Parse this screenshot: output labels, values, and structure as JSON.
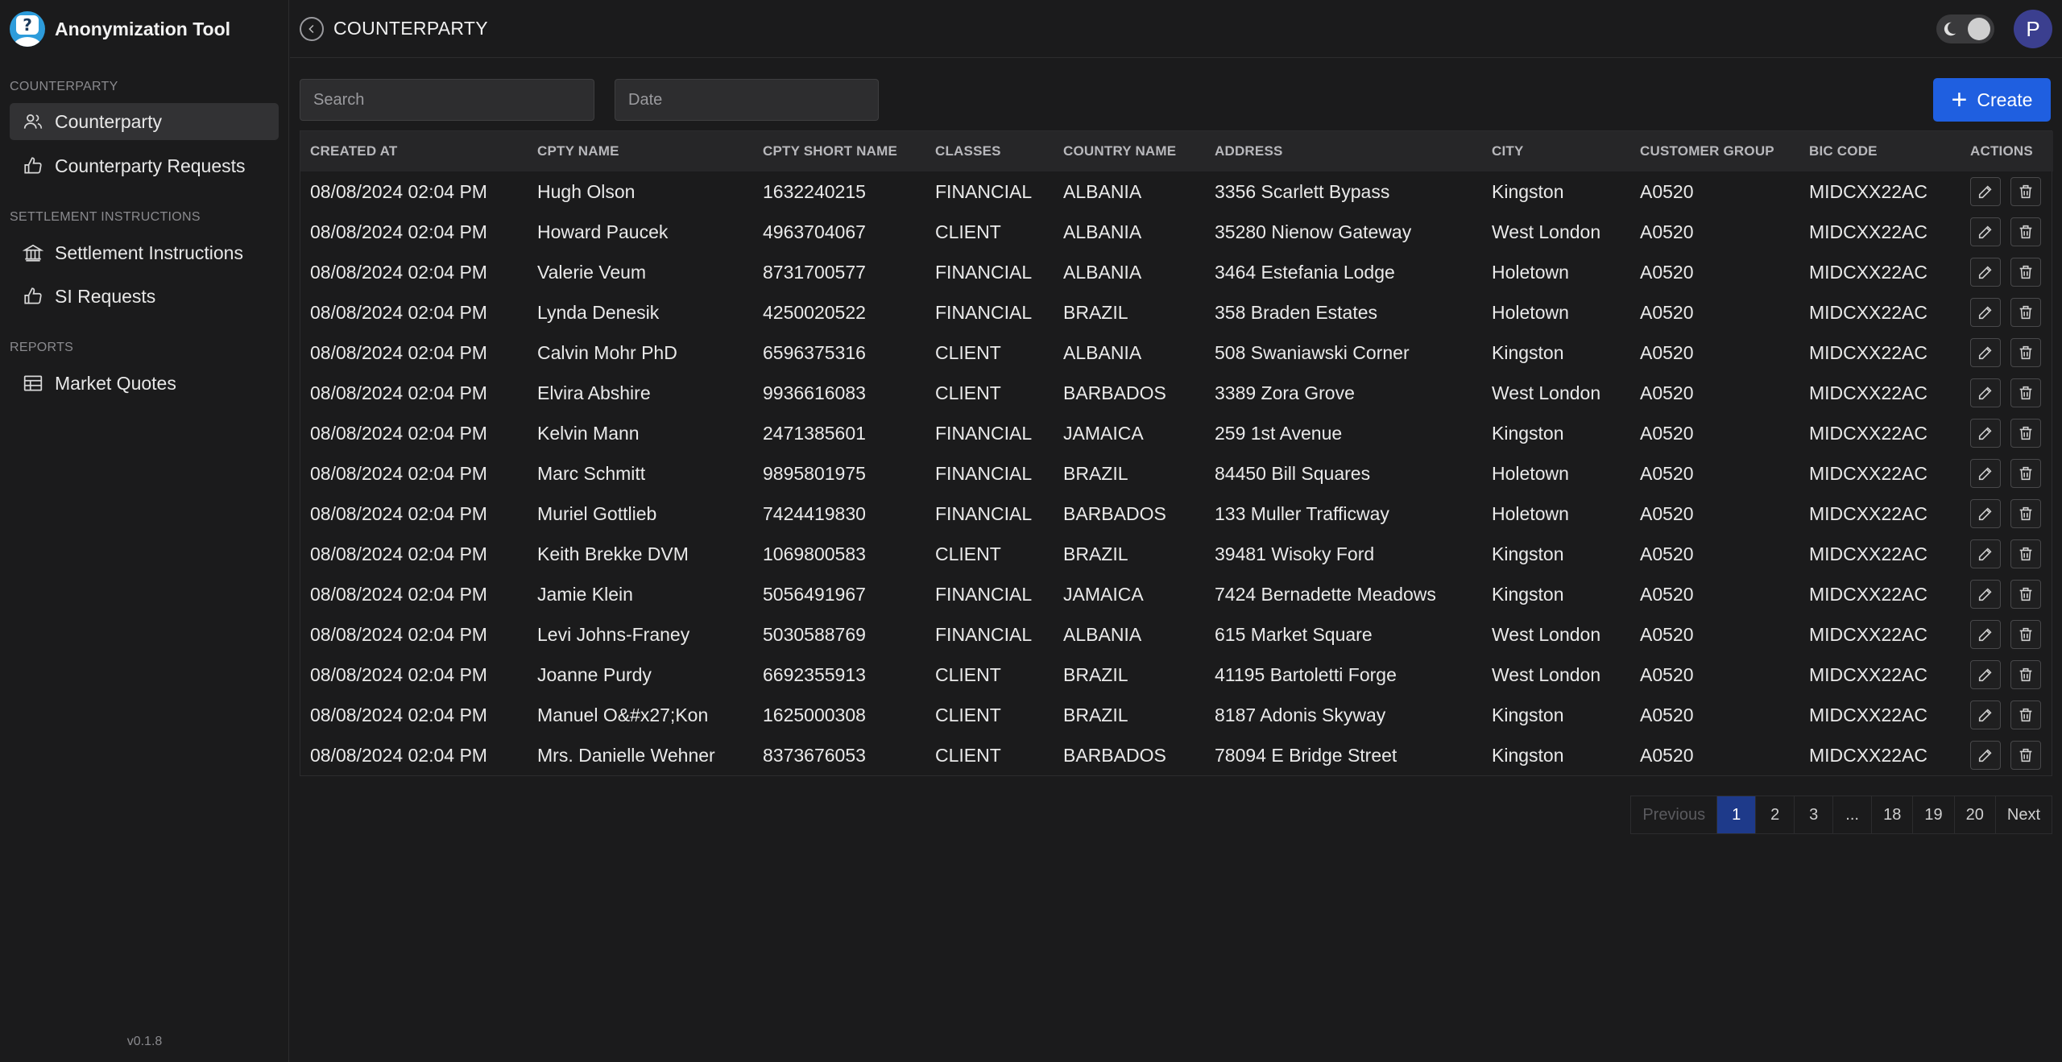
{
  "app": {
    "title": "Anonymization Tool",
    "version": "v0.1.8"
  },
  "sidebar": {
    "sections": [
      {
        "label": "COUNTERPARTY",
        "items": [
          {
            "label": "Counterparty",
            "icon": "users-icon",
            "active": true
          },
          {
            "label": "Counterparty Requests",
            "icon": "thumbs-up-icon",
            "active": false
          }
        ]
      },
      {
        "label": "SETTLEMENT INSTRUCTIONS",
        "items": [
          {
            "label": "Settlement Instructions",
            "icon": "bank-icon",
            "active": false
          },
          {
            "label": "SI Requests",
            "icon": "thumbs-up-icon",
            "active": false
          }
        ]
      },
      {
        "label": "REPORTS",
        "items": [
          {
            "label": "Market Quotes",
            "icon": "table-icon",
            "active": false
          }
        ]
      }
    ]
  },
  "header": {
    "title": "COUNTERPARTY",
    "avatar_initial": "P"
  },
  "filters": {
    "search_placeholder": "Search",
    "date_placeholder": "Date"
  },
  "toolbar": {
    "create_label": "Create"
  },
  "colors": {
    "accent": "#1f5fe0",
    "active_page": "#1e3a8a",
    "background": "#1b1b1c"
  },
  "table": {
    "columns": [
      "CREATED AT",
      "CPTY NAME",
      "CPTY SHORT NAME",
      "CLASSES",
      "COUNTRY NAME",
      "ADDRESS",
      "CITY",
      "CUSTOMER GROUP",
      "BIC CODE",
      "ACTIONS"
    ],
    "rows": [
      [
        "08/08/2024 02:04 PM",
        "Hugh Olson",
        "1632240215",
        "FINANCIAL",
        "ALBANIA",
        "3356 Scarlett Bypass",
        "Kingston",
        "A0520",
        "MIDCXX22AC"
      ],
      [
        "08/08/2024 02:04 PM",
        "Howard Paucek",
        "4963704067",
        "CLIENT",
        "ALBANIA",
        "35280 Nienow Gateway",
        "West London",
        "A0520",
        "MIDCXX22AC"
      ],
      [
        "08/08/2024 02:04 PM",
        "Valerie Veum",
        "8731700577",
        "FINANCIAL",
        "ALBANIA",
        "3464 Estefania Lodge",
        "Holetown",
        "A0520",
        "MIDCXX22AC"
      ],
      [
        "08/08/2024 02:04 PM",
        "Lynda Denesik",
        "4250020522",
        "FINANCIAL",
        "BRAZIL",
        "358 Braden Estates",
        "Holetown",
        "A0520",
        "MIDCXX22AC"
      ],
      [
        "08/08/2024 02:04 PM",
        "Calvin Mohr PhD",
        "6596375316",
        "CLIENT",
        "ALBANIA",
        "508 Swaniawski Corner",
        "Kingston",
        "A0520",
        "MIDCXX22AC"
      ],
      [
        "08/08/2024 02:04 PM",
        "Elvira Abshire",
        "9936616083",
        "CLIENT",
        "BARBADOS",
        "3389 Zora Grove",
        "West London",
        "A0520",
        "MIDCXX22AC"
      ],
      [
        "08/08/2024 02:04 PM",
        "Kelvin Mann",
        "2471385601",
        "FINANCIAL",
        "JAMAICA",
        "259 1st Avenue",
        "Kingston",
        "A0520",
        "MIDCXX22AC"
      ],
      [
        "08/08/2024 02:04 PM",
        "Marc Schmitt",
        "9895801975",
        "FINANCIAL",
        "BRAZIL",
        "84450 Bill Squares",
        "Holetown",
        "A0520",
        "MIDCXX22AC"
      ],
      [
        "08/08/2024 02:04 PM",
        "Muriel Gottlieb",
        "7424419830",
        "FINANCIAL",
        "BARBADOS",
        "133 Muller Trafficway",
        "Holetown",
        "A0520",
        "MIDCXX22AC"
      ],
      [
        "08/08/2024 02:04 PM",
        "Keith Brekke DVM",
        "1069800583",
        "CLIENT",
        "BRAZIL",
        "39481 Wisoky Ford",
        "Kingston",
        "A0520",
        "MIDCXX22AC"
      ],
      [
        "08/08/2024 02:04 PM",
        "Jamie Klein",
        "5056491967",
        "FINANCIAL",
        "JAMAICA",
        "7424 Bernadette Meadows",
        "Kingston",
        "A0520",
        "MIDCXX22AC"
      ],
      [
        "08/08/2024 02:04 PM",
        "Levi Johns-Franey",
        "5030588769",
        "FINANCIAL",
        "ALBANIA",
        "615 Market Square",
        "West London",
        "A0520",
        "MIDCXX22AC"
      ],
      [
        "08/08/2024 02:04 PM",
        "Joanne Purdy",
        "6692355913",
        "CLIENT",
        "BRAZIL",
        "41195 Bartoletti Forge",
        "West London",
        "A0520",
        "MIDCXX22AC"
      ],
      [
        "08/08/2024 02:04 PM",
        "Manuel O&#x27;Kon",
        "1625000308",
        "CLIENT",
        "BRAZIL",
        "8187 Adonis Skyway",
        "Kingston",
        "A0520",
        "MIDCXX22AC"
      ],
      [
        "08/08/2024 02:04 PM",
        "Mrs. Danielle Wehner",
        "8373676053",
        "CLIENT",
        "BARBADOS",
        "78094 E Bridge Street",
        "Kingston",
        "A0520",
        "MIDCXX22AC"
      ]
    ]
  },
  "pagination": {
    "previous": "Previous",
    "next": "Next",
    "pages": [
      "1",
      "2",
      "3",
      "...",
      "18",
      "19",
      "20"
    ],
    "current": "1"
  }
}
